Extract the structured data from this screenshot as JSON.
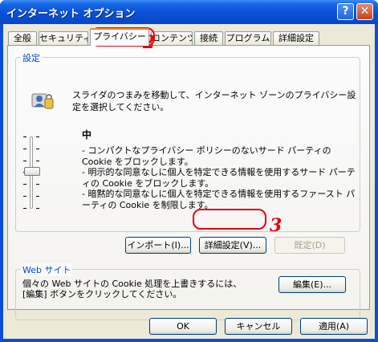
{
  "window": {
    "title": "インターネット オプション",
    "help_button": "?",
    "close_button": "✕"
  },
  "tabs": [
    {
      "label": "全般"
    },
    {
      "label": "セキュリティ"
    },
    {
      "label": "プライバシー"
    },
    {
      "label": "コンテンツ"
    },
    {
      "label": "接続"
    },
    {
      "label": "プログラム"
    },
    {
      "label": "詳細設定"
    }
  ],
  "settings": {
    "group_label": "設定",
    "intro": "スライダのつまみを移動して、インターネット ゾーンのプライバシー設定を選択してください。",
    "level": "中",
    "desc": "- コンパクトなプライバシー ポリシーのないサード パーティの Cookie をブロックします。\n- 明示的な同意なしに個人を特定できる情報を使用するサード パーティの Cookie をブロックします。\n- 暗黙的な同意なしに個人を特定できる情報を使用するファースト パーティの Cookie を制限します。",
    "import_button": "インポート(I)...",
    "advanced_button": "詳細設定(V)...",
    "default_button": "既定(D)"
  },
  "website": {
    "group_label": "Web サイト",
    "desc": "個々の Web サイトの Cookie 処理を上書きするには、\n[編集] ボタンをクリックしてください。",
    "edit_button": "編集(E)..."
  },
  "footer": {
    "ok_button": "OK",
    "cancel_button": "キャンセル",
    "apply_button": "適用(A)"
  },
  "annotations": {
    "step2": "2",
    "step3": "3"
  },
  "colors": {
    "accent_red": "#e30613",
    "group_label_blue": "#0046d5",
    "titlebar_blue": "#0a4fd6"
  }
}
